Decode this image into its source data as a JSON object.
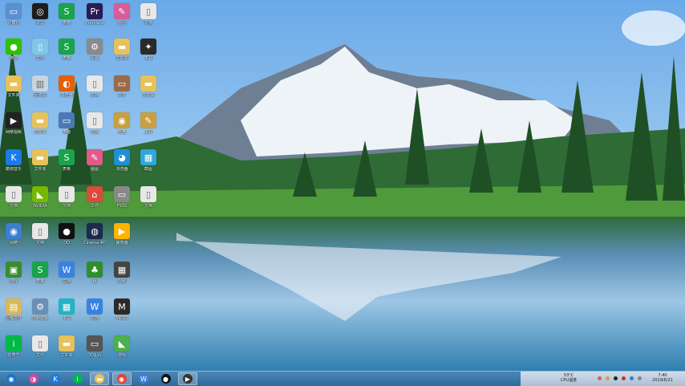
{
  "desktop": {
    "icons": [
      {
        "label": "计算机",
        "glyph": "▭",
        "color": "#5b8fd1",
        "icon": "computer-icon"
      },
      {
        "label": "微信",
        "glyph": "●",
        "color": "#2dc100",
        "icon": "wechat-icon"
      },
      {
        "label": "文件夹",
        "glyph": "▬",
        "color": "#e7c15a",
        "icon": "folder-icon"
      },
      {
        "label": "网络视频",
        "glyph": "▶",
        "color": "#222222",
        "icon": "video-icon"
      },
      {
        "label": "酷狗音乐",
        "glyph": "K",
        "color": "#1a7be6",
        "icon": "kugou-icon"
      },
      {
        "label": "文档",
        "glyph": "▯",
        "color": "#e8e8e8",
        "icon": "document-icon"
      },
      {
        "label": "网络",
        "glyph": "◉",
        "color": "#3c7fcf",
        "icon": "network-icon"
      },
      {
        "label": "游戏",
        "glyph": "▣",
        "color": "#3a8c2f",
        "icon": "game-icon"
      },
      {
        "label": "压缩文件",
        "glyph": "▤",
        "color": "#d9b85c",
        "icon": "archive-icon"
      },
      {
        "label": "爱奇艺",
        "glyph": "i",
        "color": "#00b849",
        "icon": "iqiyi-icon"
      },
      {
        "label": "录屏",
        "glyph": "◎",
        "color": "#1c1c1c",
        "icon": "recorder-icon"
      },
      {
        "label": "文件",
        "glyph": "▯",
        "color": "#7fc6e8",
        "icon": "file-icon"
      },
      {
        "label": "回收站",
        "glyph": "▥",
        "color": "#c9d4de",
        "icon": "recycle-bin-icon"
      },
      {
        "label": "文件夹",
        "glyph": "▬",
        "color": "#e7c15a",
        "icon": "folder-icon"
      },
      {
        "label": "文件夹",
        "glyph": "▬",
        "color": "#e7c15a",
        "icon": "folder-icon"
      },
      {
        "label": "NVIDIA",
        "glyph": "◣",
        "color": "#76b900",
        "icon": "nvidia-icon"
      },
      {
        "label": "文档",
        "glyph": "▯",
        "color": "#e8e8e8",
        "icon": "document-icon"
      },
      {
        "label": "表格",
        "glyph": "S",
        "color": "#19a34a",
        "icon": "spreadsheet-icon"
      },
      {
        "label": "控制面板",
        "glyph": "⚙",
        "color": "#6a8fb5",
        "icon": "control-panel-icon"
      },
      {
        "label": "文件",
        "glyph": "▯",
        "color": "#e8e8e8",
        "icon": "file-icon"
      },
      {
        "label": "表格",
        "glyph": "S",
        "color": "#19a34a",
        "icon": "spreadsheet-icon"
      },
      {
        "label": "表格",
        "glyph": "S",
        "color": "#19a34a",
        "icon": "spreadsheet-icon"
      },
      {
        "label": "浏览器",
        "glyph": "◐",
        "color": "#e66000",
        "icon": "browser-icon"
      },
      {
        "label": "电脑",
        "glyph": "▭",
        "color": "#4a7ab5",
        "icon": "monitor-icon"
      },
      {
        "label": "表格",
        "glyph": "S",
        "color": "#19a34a",
        "icon": "spreadsheet-icon"
      },
      {
        "label": "文档",
        "glyph": "▯",
        "color": "#e8e8e8",
        "icon": "document-icon"
      },
      {
        "label": "QQ",
        "glyph": "●",
        "color": "#111111",
        "icon": "qq-icon"
      },
      {
        "label": "文档",
        "glyph": "W",
        "color": "#3b82e0",
        "icon": "word-icon"
      },
      {
        "label": "工具",
        "glyph": "▦",
        "color": "#1fb5c4",
        "icon": "tool-icon"
      },
      {
        "label": "文件夹",
        "glyph": "▬",
        "color": "#e7c15a",
        "icon": "folder-icon"
      },
      {
        "label": "Premiere",
        "glyph": "Pr",
        "color": "#2a1a55",
        "icon": "premiere-icon"
      },
      {
        "label": "设置",
        "glyph": "⚙",
        "color": "#8a8a8a",
        "icon": "settings-icon"
      },
      {
        "label": "文档",
        "glyph": "▯",
        "color": "#e8e8e8",
        "icon": "document-icon"
      },
      {
        "label": "文档",
        "glyph": "▯",
        "color": "#e8e8e8",
        "icon": "document-icon"
      },
      {
        "label": "画图",
        "glyph": "✎",
        "color": "#e05a8a",
        "icon": "paint-icon"
      },
      {
        "label": "工作",
        "glyph": "⌂",
        "color": "#d94b3a",
        "icon": "home-icon"
      },
      {
        "label": "Cinema 4D",
        "glyph": "◍",
        "color": "#1c2b4a",
        "icon": "cinema4d-icon"
      },
      {
        "label": "树",
        "glyph": "♣",
        "color": "#2f8f2f",
        "icon": "tree-icon"
      },
      {
        "label": "文档",
        "glyph": "W",
        "color": "#3b82e0",
        "icon": "word-icon"
      },
      {
        "label": "QQ图片",
        "glyph": "▭",
        "color": "#555555",
        "icon": "image-icon"
      },
      {
        "label": "画图",
        "glyph": "✎",
        "color": "#d85c9a",
        "icon": "paint-icon"
      },
      {
        "label": "文件夹",
        "glyph": "▬",
        "color": "#e7c15a",
        "icon": "folder-icon"
      },
      {
        "label": "文件",
        "glyph": "▭",
        "color": "#9a6b4a",
        "icon": "file-icon"
      },
      {
        "label": "光盘",
        "glyph": "◉",
        "color": "#c8a040",
        "icon": "disc-icon"
      },
      {
        "label": "浏览器",
        "glyph": "◕",
        "color": "#1e90d6",
        "icon": "browser-icon"
      },
      {
        "label": "FSSS",
        "glyph": "▭",
        "color": "#888888",
        "icon": "app-icon"
      },
      {
        "label": "播放器",
        "glyph": "▶",
        "color": "#ffb300",
        "icon": "player-icon"
      },
      {
        "label": "视频",
        "glyph": "▦",
        "color": "#444444",
        "icon": "video-icon"
      },
      {
        "label": "MCGS",
        "glyph": "M",
        "color": "#2a2a2a",
        "icon": "mcgs-icon"
      },
      {
        "label": "游戏",
        "glyph": "◣",
        "color": "#4caf50",
        "icon": "game-icon"
      },
      {
        "label": "文档",
        "glyph": "▯",
        "color": "#e8e8e8",
        "icon": "document-icon"
      },
      {
        "label": "工具",
        "glyph": "✦",
        "color": "#2a2a2a",
        "icon": "tool-icon"
      },
      {
        "label": "文件夹",
        "glyph": "▬",
        "color": "#e7c15a",
        "icon": "folder-icon"
      },
      {
        "label": "工具",
        "glyph": "✎",
        "color": "#c8a040",
        "icon": "tool-icon"
      },
      {
        "label": "截图",
        "glyph": "▦",
        "color": "#2fa8d8",
        "icon": "screenshot-icon"
      },
      {
        "label": "文档",
        "glyph": "▯",
        "color": "#e8e8e8",
        "icon": "document-icon"
      }
    ]
  },
  "taskbar": {
    "buttons": [
      {
        "name": "start-button",
        "glyph": "◉",
        "color": "#1e73c8",
        "active": false
      },
      {
        "name": "browser-button",
        "glyph": "◑",
        "color": "#d04a9c",
        "active": false
      },
      {
        "name": "kugou-button",
        "glyph": "K",
        "color": "#1a7be6",
        "active": false
      },
      {
        "name": "iqiyi-button",
        "glyph": "i",
        "color": "#00b849",
        "active": false
      },
      {
        "name": "folder-button",
        "glyph": "▬",
        "color": "#e7c15a",
        "active": true
      },
      {
        "name": "chrome-button",
        "glyph": "◉",
        "color": "#e34234",
        "active": true
      },
      {
        "name": "word-button",
        "glyph": "W",
        "color": "#3b82e0",
        "active": false
      },
      {
        "name": "qq-button",
        "glyph": "●",
        "color": "#111111",
        "active": false
      },
      {
        "name": "recorder-button",
        "glyph": "▶",
        "color": "#333333",
        "active": true
      }
    ]
  },
  "tray": {
    "temp": "53°C",
    "cpu_label": "CPU温度",
    "time": "7:40",
    "date": "2019/6/21",
    "status_icons": [
      "#e05a5a",
      "#e0a030",
      "#222222",
      "#d03030",
      "#3a7ad0",
      "#888888"
    ]
  }
}
